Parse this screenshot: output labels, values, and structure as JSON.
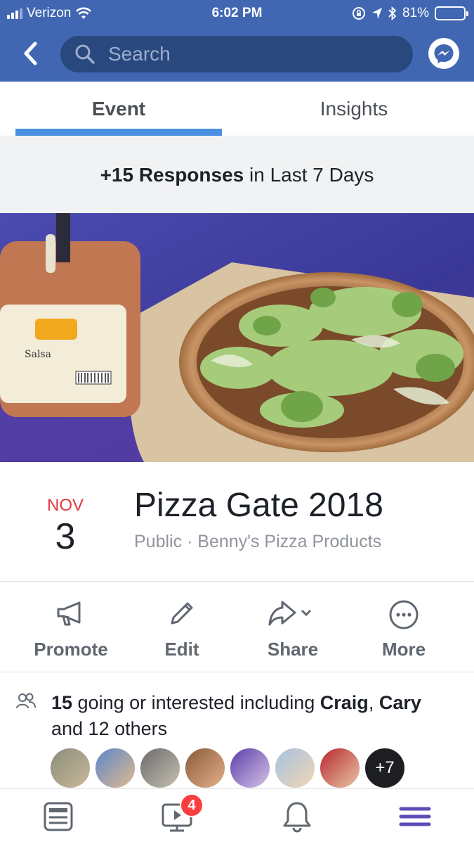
{
  "status": {
    "carrier": "Verizon",
    "time": "6:02 PM",
    "battery": "81%",
    "battery_level": 0.81
  },
  "nav": {
    "search_placeholder": "Search"
  },
  "tabs": [
    {
      "label": "Event",
      "active": true
    },
    {
      "label": "Insights",
      "active": false
    }
  ],
  "banner": {
    "bold": "+15 Responses",
    "rest": " in Last 7 Days"
  },
  "event": {
    "month": "NOV",
    "day": "3",
    "title": "Pizza Gate 2018",
    "subtitle": "Public · Benny's Pizza Products"
  },
  "actions": [
    {
      "label": "Promote",
      "icon": "megaphone-icon"
    },
    {
      "label": "Edit",
      "icon": "pencil-icon"
    },
    {
      "label": "Share",
      "icon": "share-arrow-icon"
    },
    {
      "label": "More",
      "icon": "more-dots-icon"
    }
  ],
  "going": {
    "count": "15",
    "text1": " going or interested including ",
    "name1": "Craig",
    "sep": ",",
    "name2": "Cary",
    "text2": " and 12 others",
    "more_label": "+7"
  },
  "tabbar": {
    "video_badge": "4"
  },
  "colors": {
    "brand": "#4267b2",
    "tab_underline": "#4a90e2",
    "date_month": "#e0393e",
    "badge": "#fa3e3e"
  }
}
